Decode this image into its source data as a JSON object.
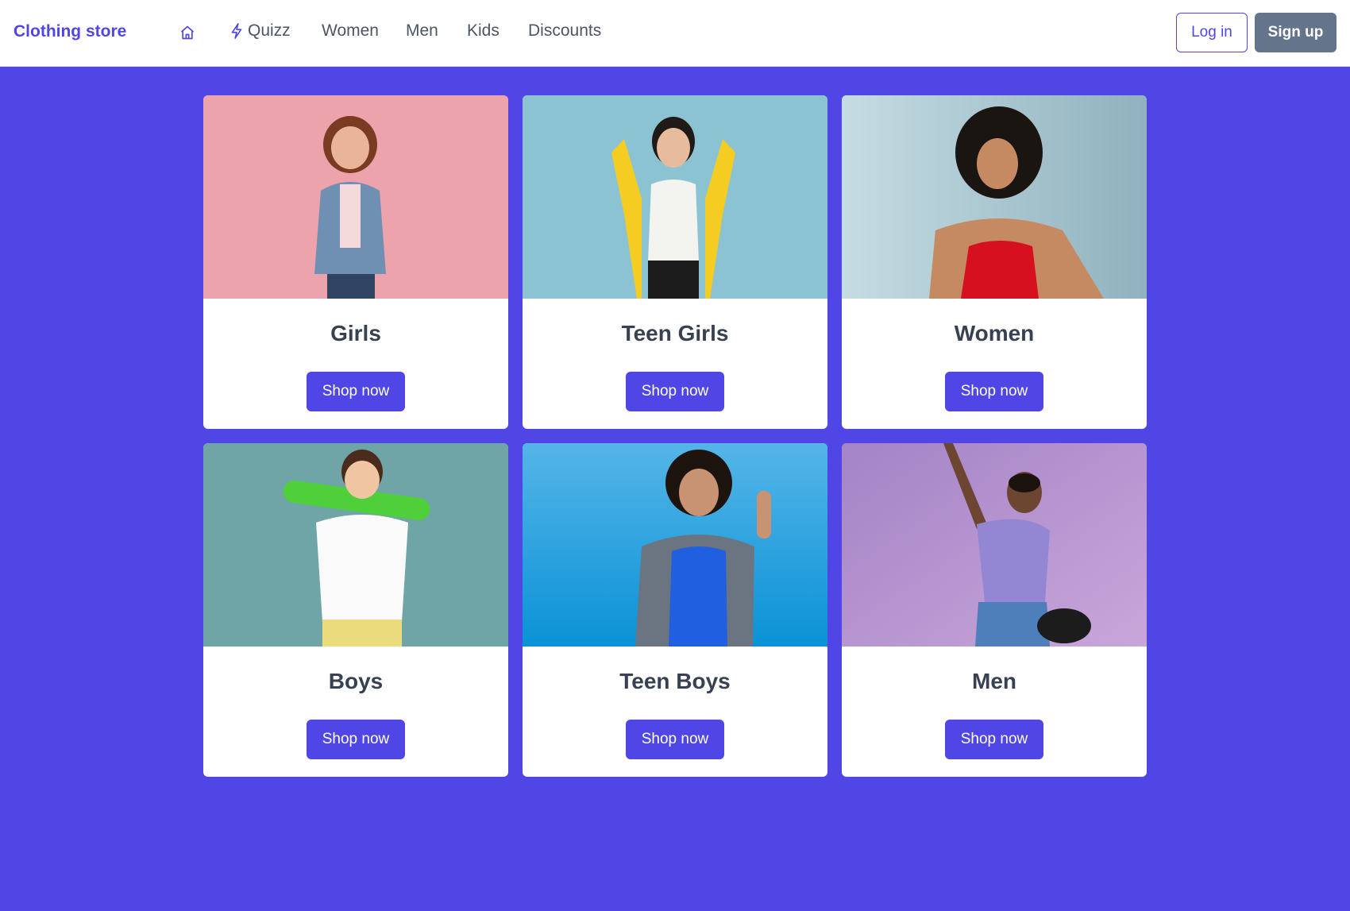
{
  "nav": {
    "brand": "Clothing store",
    "links": [
      "Quizz",
      "Women",
      "Men",
      "Kids",
      "Discounts"
    ],
    "login_label": "Log in",
    "signup_label": "Sign up",
    "home_icon": "home-icon",
    "quizz_icon": "lightning-icon"
  },
  "categories": [
    {
      "title": "Girls",
      "button": "Shop now"
    },
    {
      "title": "Teen Girls",
      "button": "Shop now"
    },
    {
      "title": "Women",
      "button": "Shop now"
    },
    {
      "title": "Boys",
      "button": "Shop now"
    },
    {
      "title": "Teen Boys",
      "button": "Shop now"
    },
    {
      "title": "Men",
      "button": "Shop now"
    }
  ],
  "colors": {
    "accent": "#4f46e5",
    "signup_bg": "#64748b"
  }
}
